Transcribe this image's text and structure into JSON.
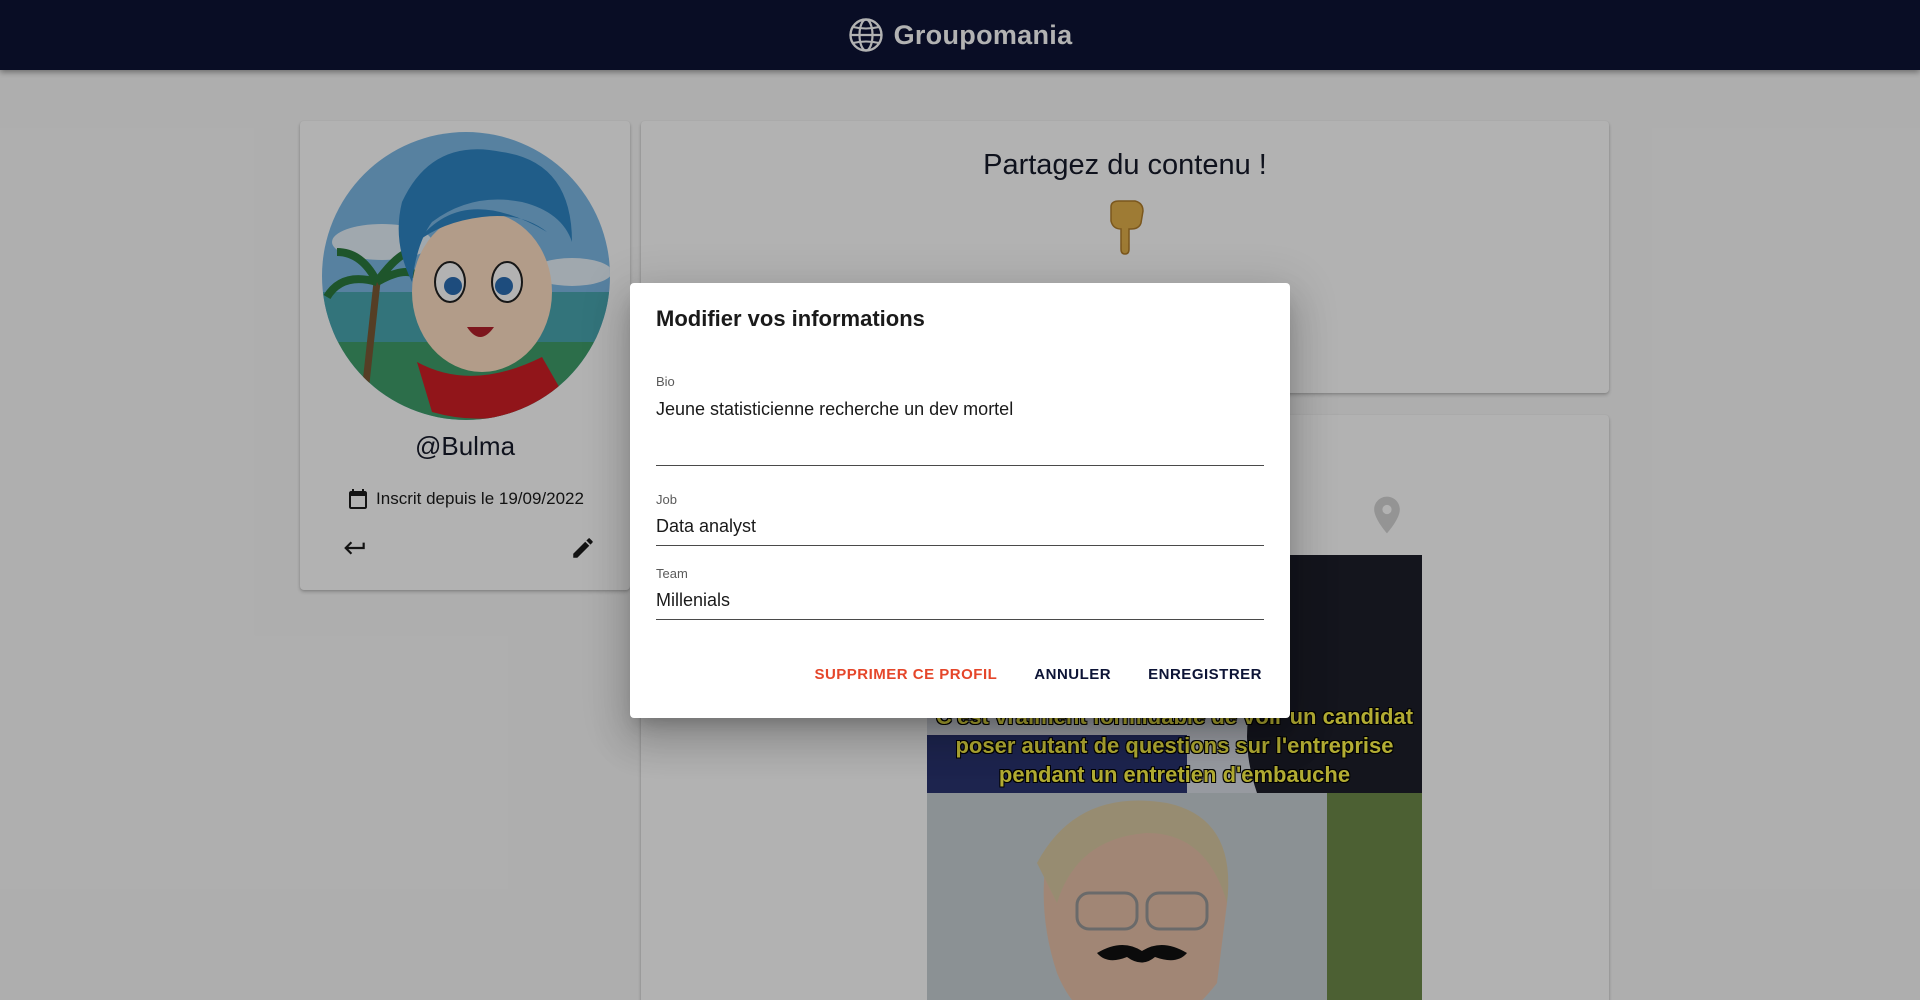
{
  "header": {
    "brand": "Groupomania",
    "logo_icon": "globe-icon"
  },
  "profile": {
    "username": "@Bulma",
    "joined_text": "Inscrit depuis le 19/09/2022",
    "calendar_icon": "calendar-icon",
    "back_icon": "return-arrow-icon",
    "edit_icon": "pencil-icon"
  },
  "share": {
    "title": "Partagez du contenu !",
    "hand_icon": "pointing-down-hand-icon"
  },
  "post": {
    "caption_lines": [
      "C'est vraiment formidable de voir un candidat",
      "poser autant de questions sur l'entreprise",
      "pendant un entretien d'embauche"
    ]
  },
  "dialog": {
    "title": "Modifier vos informations",
    "bio": {
      "label": "Bio",
      "value": "Jeune statisticienne recherche un dev mortel"
    },
    "job": {
      "label": "Job",
      "value": "Data analyst"
    },
    "team": {
      "label": "Team",
      "value": "Millenials"
    },
    "actions": {
      "delete": "SUPPRIMER CE PROFIL",
      "cancel": "ANNULER",
      "save": "ENREGISTRER"
    }
  },
  "colors": {
    "header_bg": "#0d1436",
    "danger": "#e5462a",
    "primary_text": "#0d1436"
  }
}
